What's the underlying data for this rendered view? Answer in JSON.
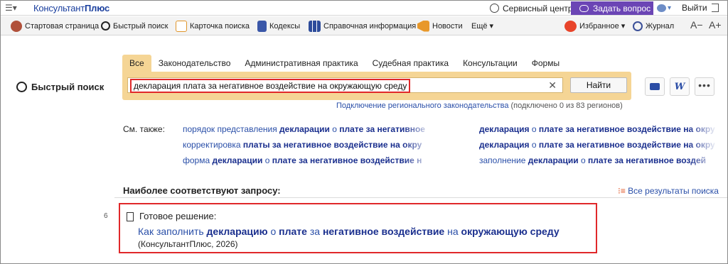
{
  "app": {
    "logo_main": "Консультант",
    "logo_tail": "Плюс"
  },
  "topbar": {
    "service_center": "Сервисный центр",
    "ask_question": "Задать вопрос",
    "logout": "Выйти"
  },
  "toolbar": {
    "start_page": "Стартовая страница",
    "quick_search": "Быстрый поиск",
    "search_card": "Карточка поиска",
    "codes": "Кодексы",
    "reference": "Справочная информация",
    "news": "Новости",
    "more": "Ещё ▾",
    "favorites": "Избранное ▾",
    "journal": "Журнал",
    "zoom_out": "A−",
    "zoom_in": "A+"
  },
  "search": {
    "section_title": "Быстрый поиск",
    "tabs": [
      "Все",
      "Законодательство",
      "Административная практика",
      "Судебная практика",
      "Консультации",
      "Формы"
    ],
    "query": "декларация плата за негативное воздействие на окружающую среду",
    "find_button": "Найти",
    "regional_link": "Подключение регионального законодательства",
    "regional_status": " (подключено 0 из 83 регионов)"
  },
  "see_also": {
    "label": "См. также:",
    "links": [
      {
        "parts": [
          [
            "порядок представления ",
            false
          ],
          [
            "декларации",
            true
          ],
          [
            " о ",
            false
          ],
          [
            "плате за негативное",
            true
          ]
        ]
      },
      {
        "parts": [
          [
            "корректировка ",
            false
          ],
          [
            "платы за негативное воздействие на окру",
            true
          ]
        ]
      },
      {
        "parts": [
          [
            "форма ",
            false
          ],
          [
            "декларации",
            true
          ],
          [
            " о ",
            false
          ],
          [
            "плате за негативное воздействие н",
            true
          ]
        ]
      },
      {
        "parts": [
          [
            "декларация",
            true
          ],
          [
            " о ",
            false
          ],
          [
            "плате за негативное воздействие на окру",
            true
          ]
        ]
      },
      {
        "parts": [
          [
            "декларация",
            true
          ],
          [
            " о ",
            false
          ],
          [
            "плате за негативное воздействие на окру",
            true
          ]
        ]
      },
      {
        "parts": [
          [
            "заполнение ",
            false
          ],
          [
            "декларации",
            true
          ],
          [
            " о ",
            false
          ],
          [
            "плате за негативное воздей",
            true
          ]
        ]
      }
    ]
  },
  "results": {
    "heading": "Наиболее соответствуют запросу:",
    "all_results": "Все результаты поиска",
    "item": {
      "number": "6",
      "type": "Готовое решение:",
      "title_parts": [
        [
          "Как заполнить ",
          false
        ],
        [
          "декларацию",
          true
        ],
        [
          " о ",
          false
        ],
        [
          "плате",
          true
        ],
        [
          " за ",
          false
        ],
        [
          "негативное воздействие",
          true
        ],
        [
          " на ",
          false
        ],
        [
          "окружающую среду",
          true
        ]
      ],
      "source": "(КонсультантПлюс, 2026)"
    }
  },
  "colors": {
    "accent": "#6b45b5",
    "highlight": "#e0282a",
    "tab_bg": "#f5d595",
    "link": "#2a4fa8"
  }
}
